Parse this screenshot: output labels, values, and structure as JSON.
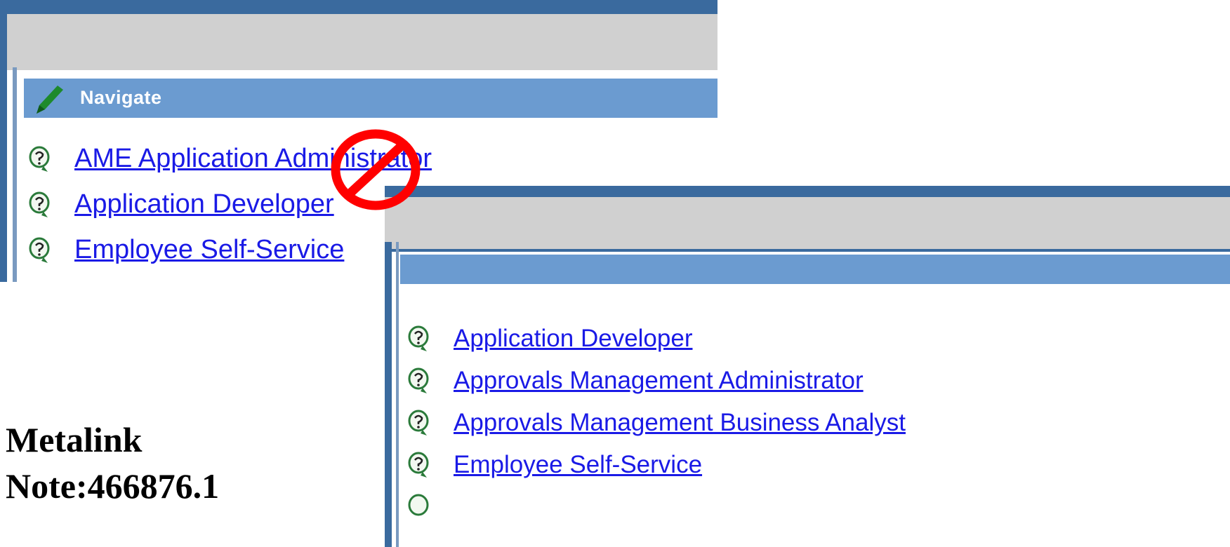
{
  "panel_top": {
    "header_title": "Navigate",
    "items": [
      "AME Application Administrator",
      "Application Developer",
      "Employee Self-Service"
    ]
  },
  "panel_bottom": {
    "header_title": "",
    "items": [
      "Application Developer",
      "Approvals Management Administrator",
      "Approvals Management Business Analyst",
      "Employee Self-Service"
    ]
  },
  "caption": {
    "line1": "Metalink",
    "line2": "Note:466876.1"
  },
  "colors": {
    "frame_blue": "#3a6a9e",
    "header_blue": "#6b9bd0",
    "link_blue": "#1a1ae6",
    "toolbar_gray": "#d0d0d0",
    "no_sign_red": "#ff0000",
    "pencil_green": "#1e8a2c"
  },
  "icons": {
    "header_icon": "pencil-icon",
    "item_icon": "help-icon",
    "overlay_icon": "no-sign-icon"
  }
}
